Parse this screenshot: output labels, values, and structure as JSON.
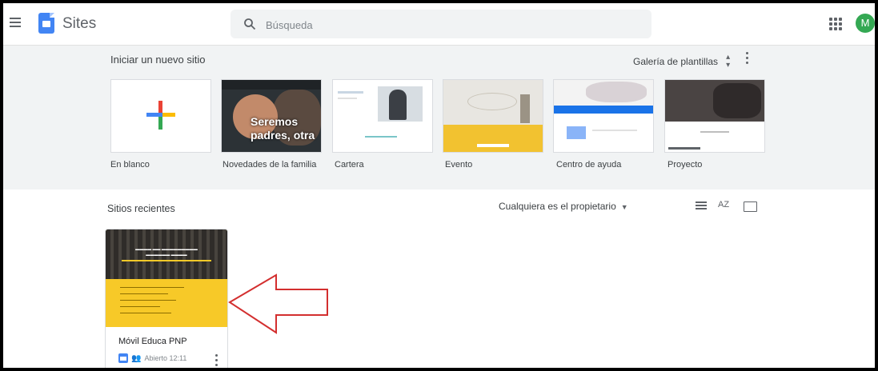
{
  "header": {
    "app_name": "Sites",
    "search_placeholder": "Búsqueda",
    "avatar_letter": "M"
  },
  "new_site": {
    "title": "Iniciar un nuevo sitio",
    "gallery_label": "Galería de plantillas",
    "templates": [
      {
        "label": "En blanco"
      },
      {
        "label": "Novedades de la familia",
        "preview_text": "Seremos padres, otra"
      },
      {
        "label": "Cartera"
      },
      {
        "label": "Evento"
      },
      {
        "label": "Centro de ayuda"
      },
      {
        "label": "Proyecto"
      }
    ]
  },
  "recent": {
    "title": "Sitios recientes",
    "owner_filter": "Cualquiera es el propietario",
    "sort_label": "AZ",
    "sites": [
      {
        "name": "Móvil Educa PNP",
        "opened": "Abierto 12:11"
      }
    ]
  },
  "colors": {
    "accent_blue": "#4285f4",
    "avatar_green": "#34a853",
    "annotation_arrow": "#d32f2f"
  }
}
